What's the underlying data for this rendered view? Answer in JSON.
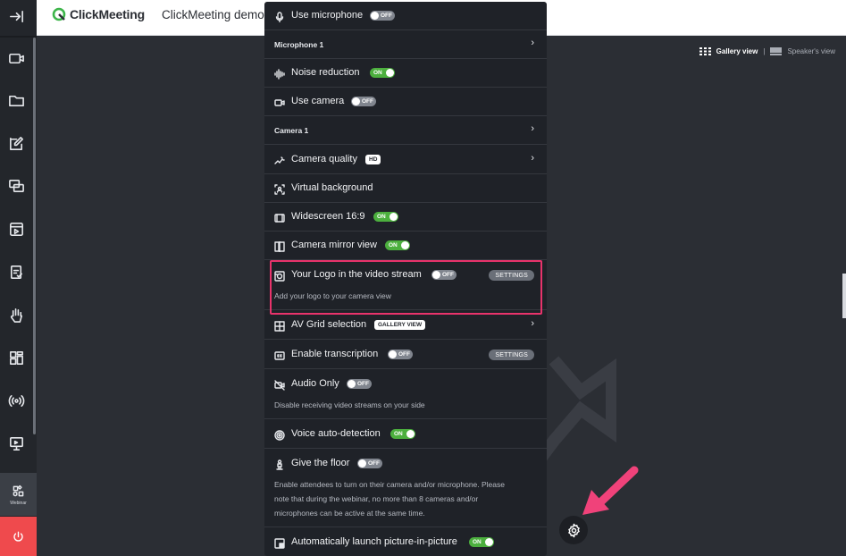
{
  "header": {
    "brand": "ClickMeeting",
    "meeting_title": "ClickMeeting demo"
  },
  "view_switch": {
    "gallery": "Gallery view",
    "separator": "|",
    "speaker": "Speaker's view"
  },
  "sidebar": {
    "webinar_label": "Webinar",
    "items": [
      "exit-icon",
      "camera-icon",
      "folder-icon",
      "edit-icon",
      "screen-share-icon",
      "video-playlist-icon",
      "checklist-icon",
      "hand-icon",
      "layout-icon",
      "broadcast-icon",
      "presentation-icon"
    ]
  },
  "settings": {
    "use_microphone": {
      "label": "Use microphone",
      "toggle": "OFF"
    },
    "microphone_device": "Microphone 1",
    "noise_reduction": {
      "label": "Noise reduction",
      "toggle": "ON"
    },
    "use_camera": {
      "label": "Use camera",
      "toggle": "OFF"
    },
    "camera_device": "Camera 1",
    "camera_quality": {
      "label": "Camera quality",
      "badge": "HD"
    },
    "virtual_background": {
      "label": "Virtual background"
    },
    "widescreen": {
      "label": "Widescreen 16:9",
      "toggle": "ON"
    },
    "mirror": {
      "label": "Camera mirror view",
      "toggle": "ON"
    },
    "logo_stream": {
      "label": "Your Logo in the video stream",
      "toggle": "OFF",
      "settings": "SETTINGS",
      "description": "Add your logo to your camera view"
    },
    "av_grid": {
      "label": "AV Grid selection",
      "badge": "GALLERY VIEW"
    },
    "transcription": {
      "label": "Enable transcription",
      "toggle": "OFF",
      "settings": "SETTINGS"
    },
    "audio_only": {
      "label": "Audio Only",
      "toggle": "OFF",
      "description": "Disable receiving video streams on your side"
    },
    "voice_detection": {
      "label": "Voice auto-detection",
      "toggle": "ON"
    },
    "give_floor": {
      "label": "Give the floor",
      "toggle": "OFF",
      "description_lines": [
        "Enable attendees to turn on their camera and/or microphone. Please",
        "note that during the webinar, no more than 8 cameras and/or",
        "microphones can be active at the same time."
      ]
    },
    "pip": {
      "label": "Automatically launch picture-in-picture",
      "toggle": "ON"
    }
  },
  "colors": {
    "highlight": "#e8336b",
    "toggle_on": "#4caf3e",
    "toggle_off": "#80858e",
    "power": "#ef4a4d",
    "brand_green": "#3db54a"
  }
}
